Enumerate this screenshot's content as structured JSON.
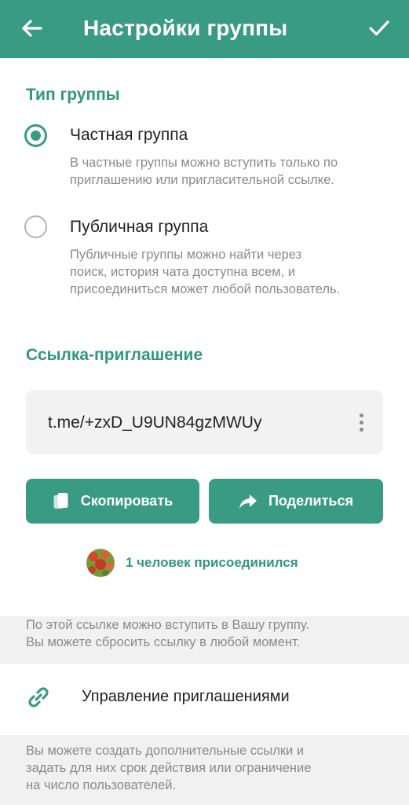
{
  "header": {
    "title": "Настройки группы",
    "back_icon": "arrow-left-icon",
    "done_icon": "checkmark-icon",
    "color": "#3a9b85"
  },
  "group_type": {
    "section_title": "Тип группы",
    "options": [
      {
        "label": "Частная группа",
        "description_lines": [
          "В частные группы можно вступить только по",
          "приглашению или пригласительной ссылке."
        ],
        "selected": true
      },
      {
        "label": "Публичная группа",
        "description_lines": [
          "Публичные группы можно найти через",
          "поиск, история чата доступна всем, и",
          "присоединиться может любой пользователь."
        ],
        "selected": false
      }
    ]
  },
  "invite_link": {
    "section_title": "Ссылка-приглашение",
    "link": "t.me/+zxD_U9UN84gzMWUy",
    "more_icon": "more-vertical-icon",
    "copy_label": "Скопировать",
    "copy_icon": "copy-icon",
    "share_label": "Поделиться",
    "share_icon": "share-arrow-icon",
    "joined_text": "1 человек присоединился",
    "note_lines": [
      "По этой ссылке можно вступить в Вашу группу.",
      "Вы можете сбросить ссылку в любой момент."
    ]
  },
  "manage_invites": {
    "label": "Управление приглашениями",
    "icon": "link-icon",
    "note_lines": [
      "Вы можете создать дополнительные ссылки и",
      "задать для них срок действия или ограничение",
      "на число пользователей."
    ]
  },
  "accent_color": "#2f9680"
}
